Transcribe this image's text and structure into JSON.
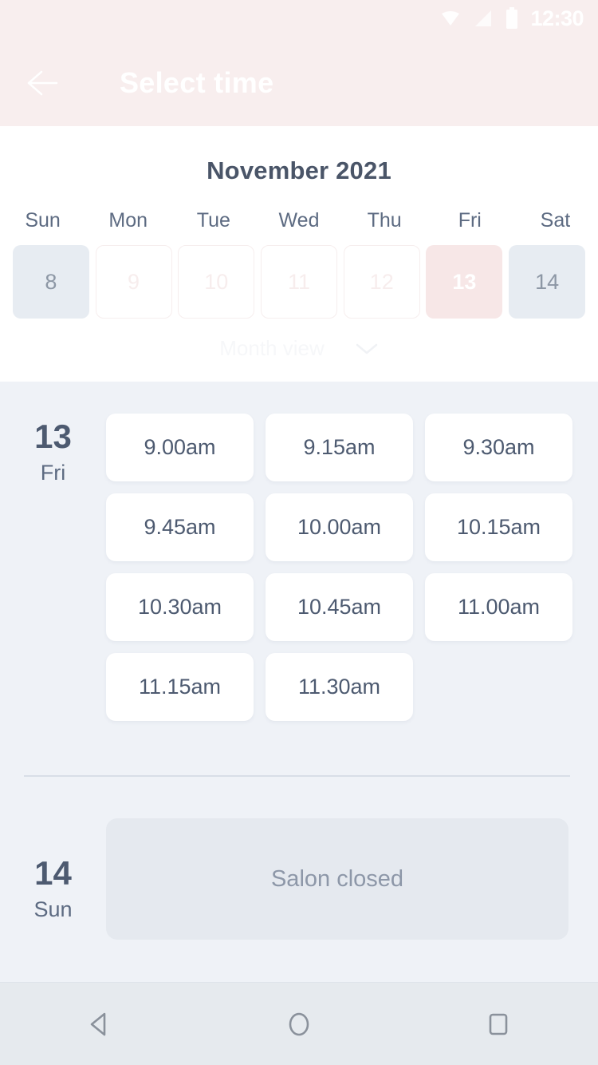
{
  "status_bar": {
    "time": "12:30",
    "icons": [
      "wifi-icon",
      "signal-icon",
      "battery-icon"
    ]
  },
  "header": {
    "title": "Select time",
    "back_icon": "back-arrow-icon",
    "background_color": "#f8eeee"
  },
  "calendar": {
    "month_title": "November 2021",
    "weekdays": [
      "Sun",
      "Mon",
      "Tue",
      "Wed",
      "Thu",
      "Fri",
      "Sat"
    ],
    "days": [
      {
        "number": "8",
        "state": "closed"
      },
      {
        "number": "9",
        "state": "normal"
      },
      {
        "number": "10",
        "state": "normal"
      },
      {
        "number": "11",
        "state": "normal"
      },
      {
        "number": "12",
        "state": "normal"
      },
      {
        "number": "13",
        "state": "selected"
      },
      {
        "number": "14",
        "state": "closed"
      }
    ],
    "view_toggle": {
      "label": "Month view",
      "icon": "chevron-down-icon"
    },
    "selected_color": "#f7e7e7",
    "closed_color": "#e7ecf2"
  },
  "schedule": [
    {
      "day_number": "13",
      "day_of_week": "Fri",
      "slots": [
        "9.00am",
        "9.15am",
        "9.30am",
        "9.45am",
        "10.00am",
        "10.15am",
        "10.30am",
        "10.45am",
        "11.00am",
        "11.15am",
        "11.30am"
      ],
      "closed_message": null
    },
    {
      "day_number": "14",
      "day_of_week": "Sun",
      "slots": [],
      "closed_message": "Salon closed"
    }
  ],
  "nav_bar": {
    "buttons": [
      "back-triangle-icon",
      "home-circle-icon",
      "recents-square-icon"
    ]
  }
}
